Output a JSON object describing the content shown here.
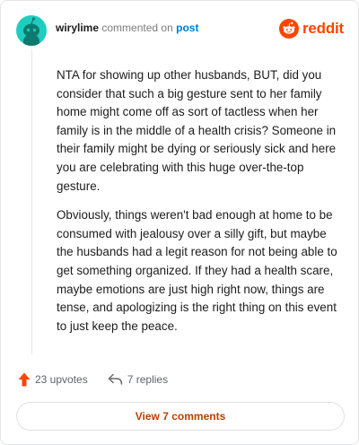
{
  "comment": {
    "username": "wirylime",
    "action_text": "commented on",
    "link_text": "post",
    "paragraphs": [
      "NTA for showing up other husbands, BUT, did you consider that such a big gesture sent to her family home might come off as sort of tactless when her family is in the middle of a health crisis? Someone in their family might be dying or seriously sick and here you are celebrating with this huge over-the-top gesture.",
      "Obviously, things weren't bad enough at home to be consumed with jealousy over a silly gift, but maybe the husbands had a legit reason for not being able to get something organized. If they had a health scare, maybe emotions are just high right now, things are tense, and apologizing is the right thing on this event to just keep the peace."
    ]
  },
  "brand": {
    "wordmark": "reddit",
    "color": "#ff4500"
  },
  "actions": {
    "upvotes": "23 upvotes",
    "replies": "7 replies",
    "upvote_icon": "upvote-arrow-icon",
    "reply_icon": "reply-arrow-icon"
  },
  "view_button": {
    "label": "View 7 comments",
    "color": "#b94000"
  },
  "colors": {
    "avatar_bg": "#1fcdbf",
    "link": "#0079d3"
  }
}
